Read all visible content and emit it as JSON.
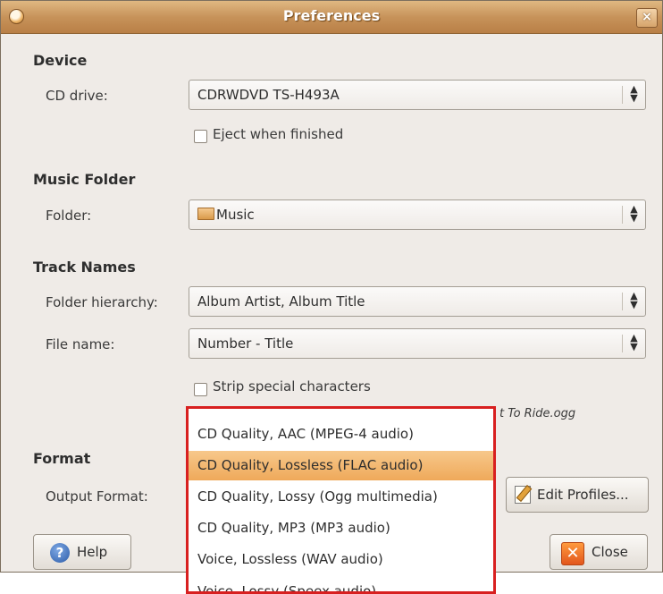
{
  "window": {
    "title": "Preferences",
    "close_glyph": "×"
  },
  "device": {
    "heading": "Device",
    "cd_drive_label": "CD drive:",
    "cd_drive_value": "CDRWDVD TS-H493A",
    "eject_label": "Eject when finished"
  },
  "music_folder": {
    "heading": "Music Folder",
    "folder_label": "Folder:",
    "folder_value": "Music",
    "folder_icon": "folder-icon"
  },
  "track_names": {
    "heading": "Track Names",
    "hierarchy_label": "Folder hierarchy:",
    "hierarchy_value": "Album Artist, Album Title",
    "filename_label": "File name:",
    "filename_value": "Number - Title",
    "strip_label": "Strip special characters",
    "preview_text": "t To Ride.ogg"
  },
  "format": {
    "heading": "Format",
    "output_label": "Output Format:",
    "edit_profiles_label": "Edit Profiles..."
  },
  "dropdown": {
    "items": [
      "CD Quality, AAC (MPEG-4 audio)",
      "CD Quality, Lossless (FLAC audio)",
      "CD Quality, Lossy (Ogg multimedia)",
      "CD Quality, MP3 (MP3 audio)",
      "Voice, Lossless (WAV audio)",
      "Voice, Lossy (Speex audio)"
    ],
    "selected_index": 1
  },
  "buttons": {
    "help_label": "Help",
    "close_label": "Close"
  },
  "colors": {
    "title_bar": "#c7935a",
    "selection": "#efa95a",
    "highlight_border": "#d82020"
  }
}
